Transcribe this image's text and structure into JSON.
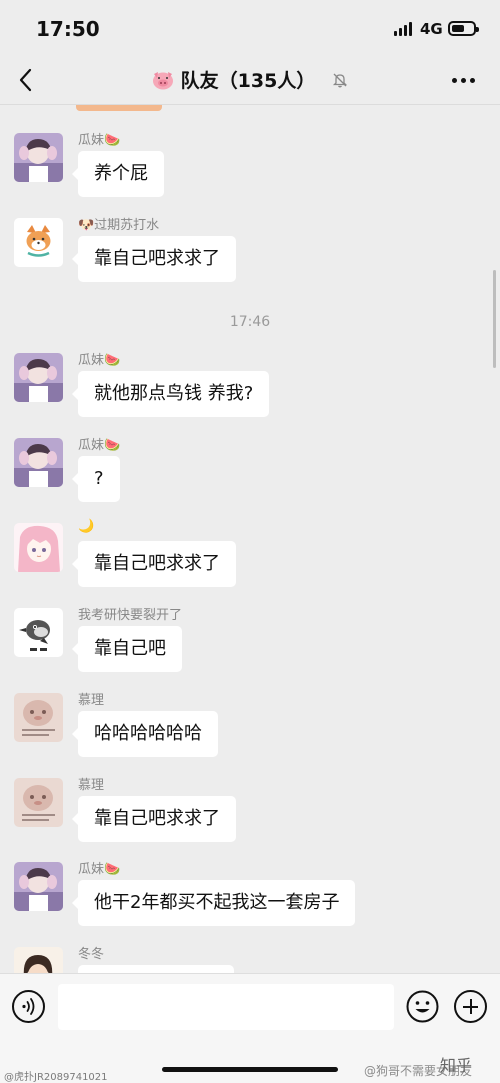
{
  "status_bar": {
    "time": "17:50",
    "network": "4G",
    "battery_level": 0.6
  },
  "header": {
    "title_prefix_icon": "pig-face-icon",
    "title": "队友（135人）",
    "mute_icon": "bell-off-icon"
  },
  "messages": [
    {
      "sender": "瓜妹🍉",
      "text": "养个屁",
      "avatar": "avatar-guamei"
    },
    {
      "sender": "🐶过期苏打水",
      "text": "靠自己吧求求了",
      "avatar": "avatar-shiba"
    },
    {
      "sender": "瓜妹🍉",
      "text": "就他那点鸟钱 养我?",
      "avatar": "avatar-guamei"
    },
    {
      "sender": "瓜妹🍉",
      "text": "?",
      "avatar": "avatar-guamei"
    },
    {
      "sender": "🌙",
      "text": "靠自己吧求求了",
      "avatar": "avatar-anime"
    },
    {
      "sender": "我考研快要裂开了",
      "text": "靠自己吧",
      "avatar": "avatar-bird"
    },
    {
      "sender": "慕理",
      "text": "哈哈哈哈哈哈",
      "avatar": "avatar-muli"
    },
    {
      "sender": "慕理",
      "text": "靠自己吧求求了",
      "avatar": "avatar-muli"
    },
    {
      "sender": "瓜妹🍉",
      "text": "他干2年都买不起我这一套房子",
      "avatar": "avatar-guamei"
    },
    {
      "sender": "冬冬",
      "text": "",
      "avatar": "avatar-dongdong"
    }
  ],
  "timestamp": "17:46",
  "input": {
    "placeholder": ""
  },
  "watermarks": {
    "left": "@虎扑JR2089741021",
    "right": "@狗哥不需要女朋友",
    "zhihu": "知乎"
  }
}
